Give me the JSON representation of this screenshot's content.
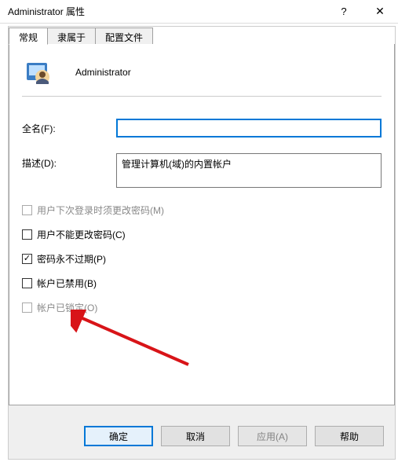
{
  "titlebar": {
    "title": "Administrator 属性",
    "help": "?",
    "close": "✕"
  },
  "tabs": [
    {
      "label": "常规"
    },
    {
      "label": "隶属于"
    },
    {
      "label": "配置文件"
    }
  ],
  "user": {
    "name": "Administrator"
  },
  "fields": {
    "fullname_label": "全名(F):",
    "fullname_value": "",
    "desc_label": "描述(D):",
    "desc_value": "管理计算机(域)的内置帐户"
  },
  "checks": {
    "must_change": "用户下次登录时须更改密码(M)",
    "cannot_change": "用户不能更改密码(C)",
    "never_expire": "密码永不过期(P)",
    "disabled": "帐户已禁用(B)",
    "locked": "帐户已锁定(O)"
  },
  "buttons": {
    "ok": "确定",
    "cancel": "取消",
    "apply": "应用(A)",
    "help": "帮助"
  }
}
